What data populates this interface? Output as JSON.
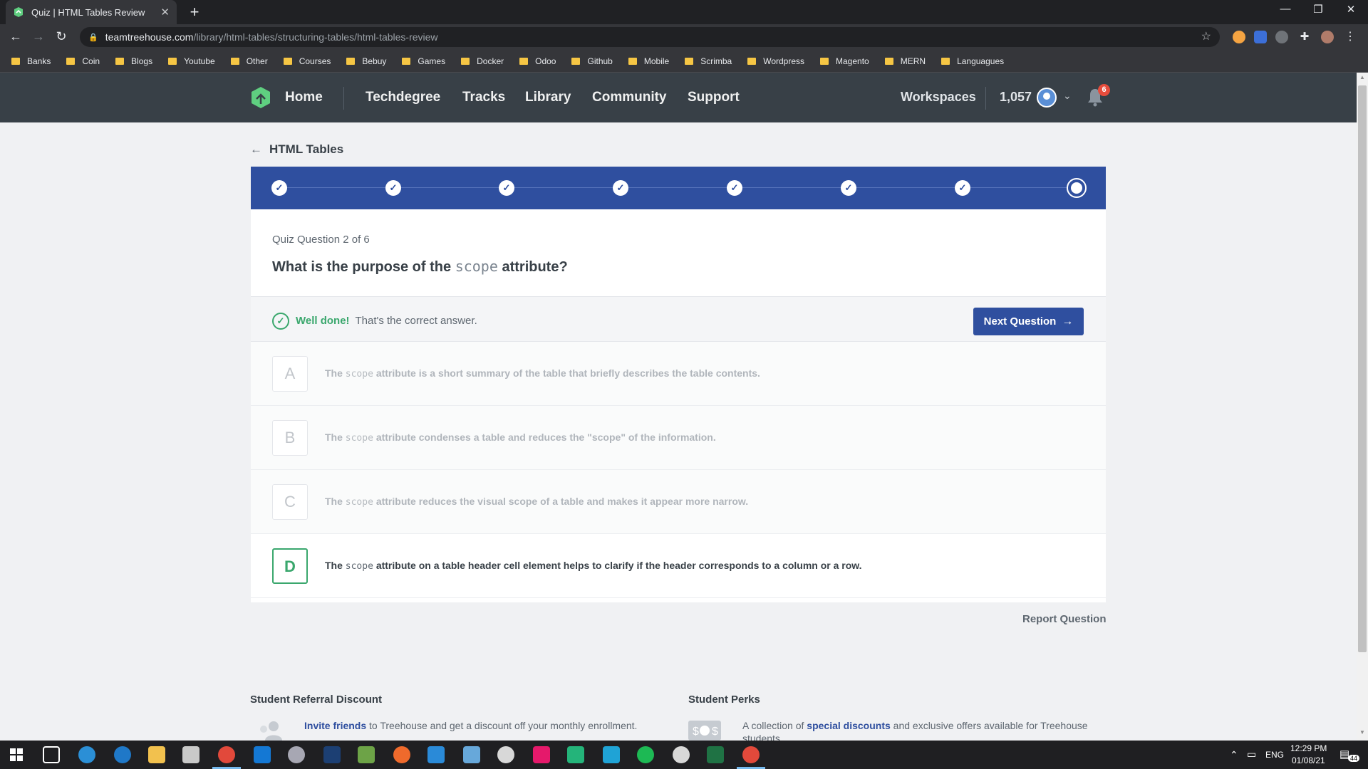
{
  "browser": {
    "tab_title": "Quiz | HTML Tables Review",
    "url_host": "teamtreehouse.com",
    "url_path": "/library/html-tables/structuring-tables/html-tables-review",
    "bookmarks": [
      "Banks",
      "Coin",
      "Blogs",
      "Youtube",
      "Other",
      "Courses",
      "Bebuy",
      "Games",
      "Docker",
      "Odoo",
      "Github",
      "Mobile",
      "Scrimba",
      "Wordpress",
      "Magento",
      "MERN",
      "Languagues"
    ]
  },
  "site_nav": {
    "home": "Home",
    "links": [
      "Techdegree",
      "Tracks",
      "Library",
      "Community",
      "Support"
    ],
    "workspaces": "Workspaces",
    "points": "1,057",
    "notification_count": "6",
    "brand_color": "#5fcf80"
  },
  "quiz": {
    "back_label": "HTML Tables",
    "progress_steps": [
      "done",
      "done",
      "done",
      "done",
      "done",
      "done",
      "done",
      "current"
    ],
    "question_count": "Quiz Question 2 of 6",
    "question_pre": "What is the purpose of the",
    "question_code": "scope",
    "question_post": "attribute?",
    "feedback_strong": "Well done!",
    "feedback_text": "That's the correct answer.",
    "next_button": "Next Question",
    "options": [
      {
        "letter": "A",
        "pre": "The",
        "code": "scope",
        "text": "attribute is a short summary of the table that briefly describes the table contents.",
        "correct": false
      },
      {
        "letter": "B",
        "pre": "The",
        "code": "scope",
        "text": "attribute condenses a table and reduces the \"scope\" of the information.",
        "correct": false
      },
      {
        "letter": "C",
        "pre": "The",
        "code": "scope",
        "text": "attribute reduces the visual scope of a table and makes it appear more narrow.",
        "correct": false
      },
      {
        "letter": "D",
        "pre": "The",
        "code": "scope",
        "text": "attribute on a table header cell element helps to clarify if the header corresponds to a column or a row.",
        "correct": true
      }
    ],
    "report_label": "Report Question",
    "accent_color": "#2f4f9f",
    "success_color": "#3aa76d"
  },
  "footer": {
    "referral_title": "Student Referral Discount",
    "referral_link": "Invite friends",
    "referral_text": "to Treehouse and get a discount off your monthly enrollment.",
    "perks_title": "Student Perks",
    "perks_pre": "A collection of",
    "perks_link": "special discounts",
    "perks_text": "and exclusive offers available for Treehouse students."
  },
  "taskbar": {
    "language": "ENG",
    "time": "12:29 PM",
    "date": "01/08/21",
    "notifications": "44"
  }
}
